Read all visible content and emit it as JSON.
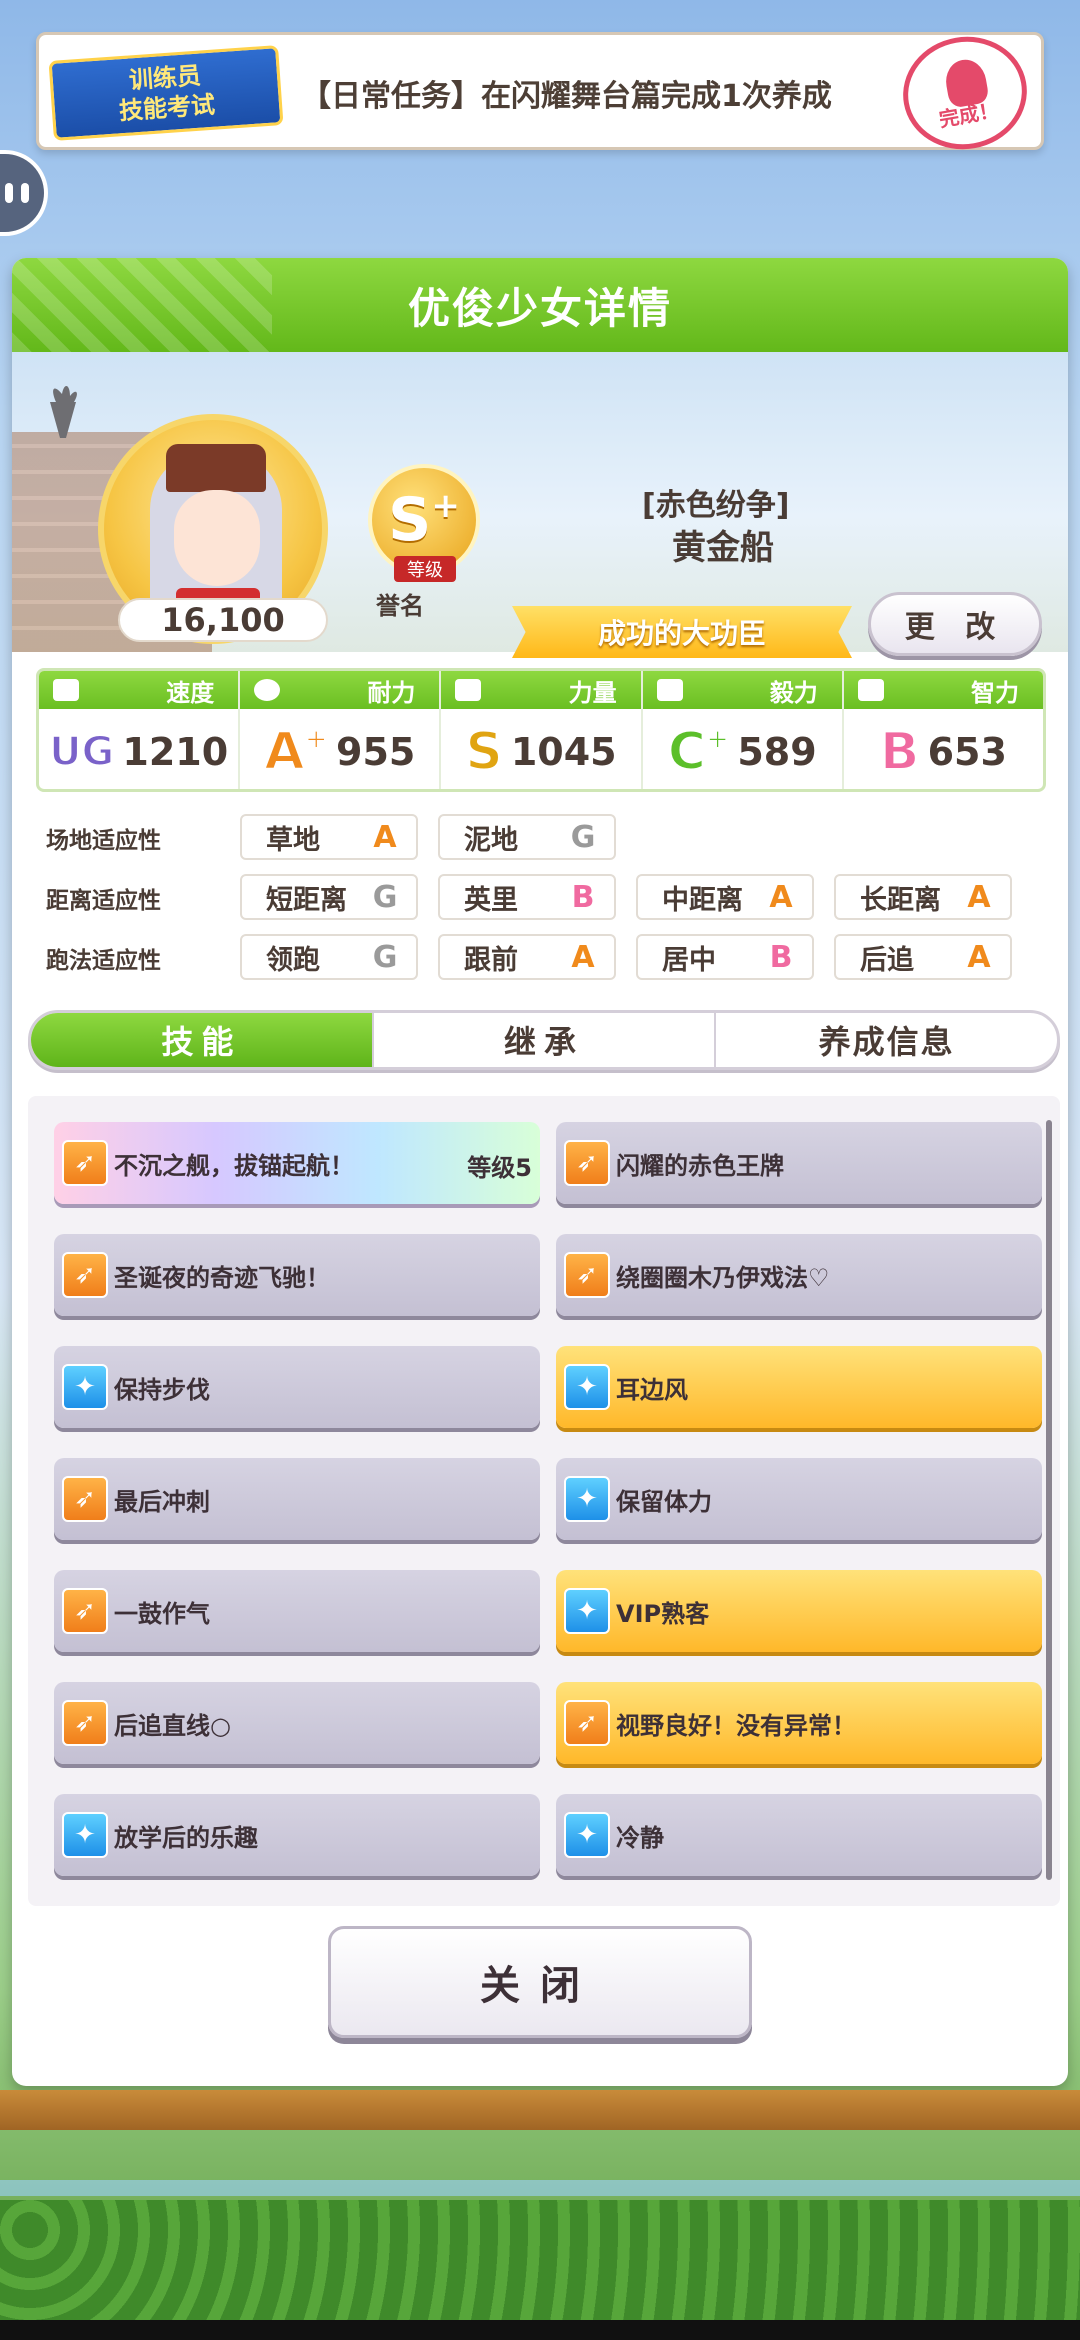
{
  "mission": {
    "logo_line1": "训练员",
    "logo_line2": "技能考试",
    "text": "【日常任务】在闪耀舞台篇完成1次养成",
    "stamp_text": "完成！"
  },
  "panel": {
    "title": "优俊少女详情"
  },
  "profile": {
    "fans": "16,100",
    "rank": "S",
    "rank_plus": "+",
    "rank_tag": "等级",
    "honor_label": "誉名",
    "epithet": "[赤色纷争]",
    "name": "黄金船",
    "title": "成功的大功臣",
    "change_label": "更 改",
    "memo": "-"
  },
  "stats": [
    {
      "label": "速度",
      "grade": "UG",
      "grade_color": "#7a62c9",
      "value": "1210"
    },
    {
      "label": "耐力",
      "grade": "A",
      "grade_plus": "+",
      "grade_color": "#f08a1c",
      "value": "955"
    },
    {
      "label": "力量",
      "grade": "S",
      "grade_color": "#e0a412",
      "value": "1045"
    },
    {
      "label": "毅力",
      "grade": "C",
      "grade_plus": "+",
      "grade_color": "#5cbf2a",
      "value": "589"
    },
    {
      "label": "智力",
      "grade": "B",
      "grade_color": "#f06aa0",
      "value": "653"
    }
  ],
  "aptitude": {
    "track_label": "场地适应性",
    "distance_label": "距离适应性",
    "style_label": "跑法适应性",
    "track": [
      {
        "name": "草地",
        "grade": "A"
      },
      {
        "name": "泥地",
        "grade": "G"
      }
    ],
    "distance": [
      {
        "name": "短距离",
        "grade": "G"
      },
      {
        "name": "英里",
        "grade": "B"
      },
      {
        "name": "中距离",
        "grade": "A"
      },
      {
        "name": "长距离",
        "grade": "A"
      }
    ],
    "style": [
      {
        "name": "领跑",
        "grade": "G"
      },
      {
        "name": "跟前",
        "grade": "A"
      },
      {
        "name": "居中",
        "grade": "B"
      },
      {
        "name": "后追",
        "grade": "A"
      }
    ]
  },
  "tabs": [
    {
      "label": "技能",
      "active": true
    },
    {
      "label": "继承",
      "active": false
    },
    {
      "label": "养成信息",
      "active": false
    }
  ],
  "skills": [
    {
      "name": "不沉之舰，拔锚起航！",
      "level": "等级5",
      "style": "rainbow",
      "icon": "runner-icon"
    },
    {
      "name": "闪耀的赤色王牌",
      "style": "normal",
      "icon": "runner-icon"
    },
    {
      "name": "圣诞夜的奇迹飞驰！",
      "style": "normal",
      "icon": "runner-icon"
    },
    {
      "name": "绕圈圈木乃伊戏法♡",
      "style": "normal",
      "icon": "runner-icon"
    },
    {
      "name": "保持步伐",
      "style": "normal",
      "icon": "sparkle-icon"
    },
    {
      "name": "耳边风",
      "style": "gold",
      "icon": "sparkle-icon"
    },
    {
      "name": "最后冲刺",
      "style": "normal",
      "icon": "runner-icon"
    },
    {
      "name": "保留体力",
      "style": "normal",
      "icon": "sparkle-icon"
    },
    {
      "name": "一鼓作气",
      "style": "normal",
      "icon": "runner-icon"
    },
    {
      "name": "VIP熟客",
      "style": "gold",
      "icon": "sparkle-icon"
    },
    {
      "name": "后追直线○",
      "style": "normal",
      "icon": "runner-icon"
    },
    {
      "name": "视野良好！没有异常！",
      "style": "gold",
      "icon": "runner-icon"
    },
    {
      "name": "放学后的乐趣",
      "style": "normal",
      "icon": "sparkle-icon"
    },
    {
      "name": "冷静",
      "style": "normal",
      "icon": "sparkle-icon"
    }
  ],
  "close_label": "关闭",
  "colors": {
    "accent_green": "#6abf22",
    "grade_A": "#f08a1c",
    "grade_B": "#f06aa0",
    "grade_G": "#9a9a9a"
  }
}
